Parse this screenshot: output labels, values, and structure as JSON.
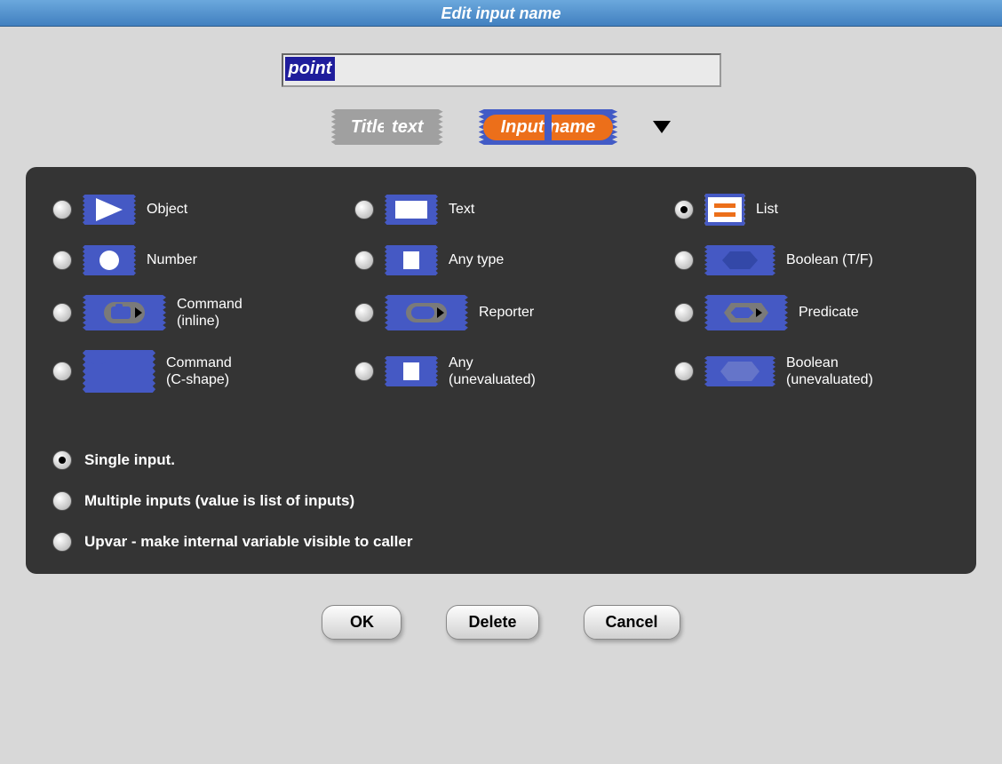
{
  "title": "Edit input name",
  "name_value": "point",
  "mode": {
    "title_text_label": "Title text",
    "input_name_label": "Input name"
  },
  "types": {
    "row1": [
      {
        "key": "object",
        "label": "Object",
        "selected": false
      },
      {
        "key": "text",
        "label": "Text",
        "selected": false
      },
      {
        "key": "list",
        "label": "List",
        "selected": true
      }
    ],
    "row2": [
      {
        "key": "number",
        "label": "Number",
        "selected": false
      },
      {
        "key": "anytype",
        "label": "Any type",
        "selected": false
      },
      {
        "key": "boolean",
        "label": "Boolean (T/F)",
        "selected": false
      }
    ],
    "row3": [
      {
        "key": "command_inline",
        "label": "Command\n(inline)",
        "selected": false
      },
      {
        "key": "reporter",
        "label": "Reporter",
        "selected": false
      },
      {
        "key": "predicate",
        "label": "Predicate",
        "selected": false
      }
    ],
    "row4": [
      {
        "key": "command_cshape",
        "label": "Command\n(C-shape)",
        "selected": false
      },
      {
        "key": "any_uneval",
        "label": "Any\n(unevaluated)",
        "selected": false
      },
      {
        "key": "bool_uneval",
        "label": "Boolean\n(unevaluated)",
        "selected": false
      }
    ]
  },
  "arity": {
    "single": {
      "label": "Single input.",
      "selected": true
    },
    "multiple": {
      "label": "Multiple inputs (value is list of inputs)",
      "selected": false
    },
    "upvar": {
      "label": "Upvar - make internal variable visible to caller",
      "selected": false
    }
  },
  "buttons": {
    "ok": "OK",
    "delete": "Delete",
    "cancel": "Cancel"
  }
}
